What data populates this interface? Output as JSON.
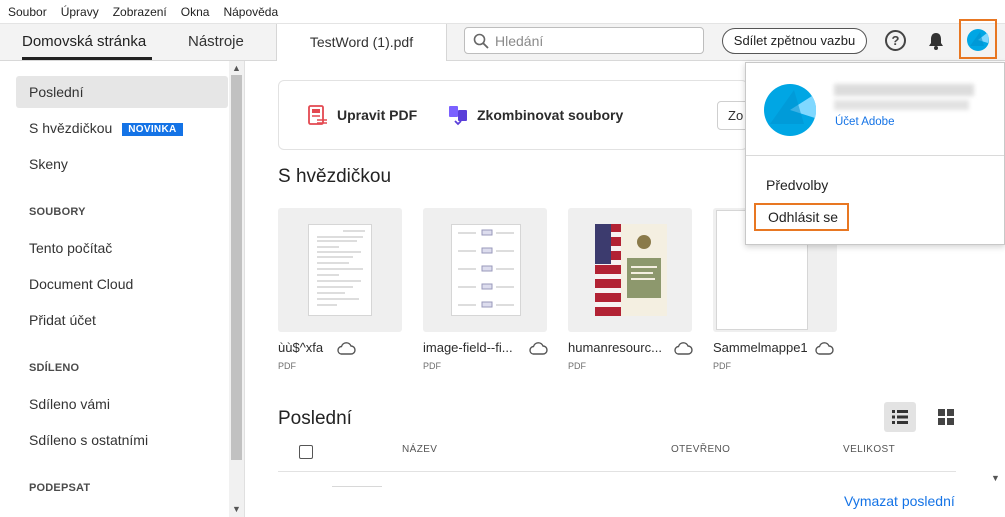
{
  "menubar": {
    "items": [
      "Soubor",
      "Úpravy",
      "Zobrazení",
      "Okna",
      "Nápověda"
    ]
  },
  "tabs": {
    "home": "Domovská stránka",
    "tools": "Nástroje",
    "document": "TestWord (1).pdf"
  },
  "search": {
    "placeholder": "Hledání",
    "value": ""
  },
  "header": {
    "feedback_label": "Sdílet zpětnou vazbu",
    "help_symbol": "?"
  },
  "sidebar": {
    "items": [
      {
        "label": "Poslední",
        "active": true
      },
      {
        "label": "S hvězdičkou",
        "badge": "NOVINKA"
      },
      {
        "label": "Skeny"
      }
    ],
    "sections": [
      {
        "heading": "SOUBORY",
        "items": [
          "Tento počítač",
          "Document Cloud",
          "Přidat účet"
        ]
      },
      {
        "heading": "SDÍLENO",
        "items": [
          "Sdíleno vámi",
          "Sdíleno s ostatními"
        ]
      },
      {
        "heading": "PODEPSAT",
        "items": []
      }
    ]
  },
  "tools_card": {
    "edit_label": "Upravit PDF",
    "combine_label": "Zkombinovat soubory",
    "more_label": "Zo"
  },
  "starred": {
    "title": "S hvězdičkou",
    "files": [
      {
        "name": "ùù$^xfa",
        "type": "PDF"
      },
      {
        "name": "image-field--fi...",
        "type": "PDF"
      },
      {
        "name": "humanresourc...",
        "type": "PDF"
      },
      {
        "name": "Sammelmappe1",
        "type": "PDF"
      }
    ]
  },
  "recent": {
    "title": "Poslední",
    "columns": {
      "name": "NÁZEV",
      "opened": "OTEVŘENO",
      "size": "VELIKOST"
    },
    "clear_label": "Vymazat poslední"
  },
  "account_popup": {
    "account_link": "Účet Adobe",
    "preferences": "Předvolby",
    "logout": "Odhlásit se"
  },
  "colors": {
    "accent_blue": "#1473e6",
    "highlight_orange": "#e87722",
    "avatar_cyan": "#00a6e4"
  }
}
